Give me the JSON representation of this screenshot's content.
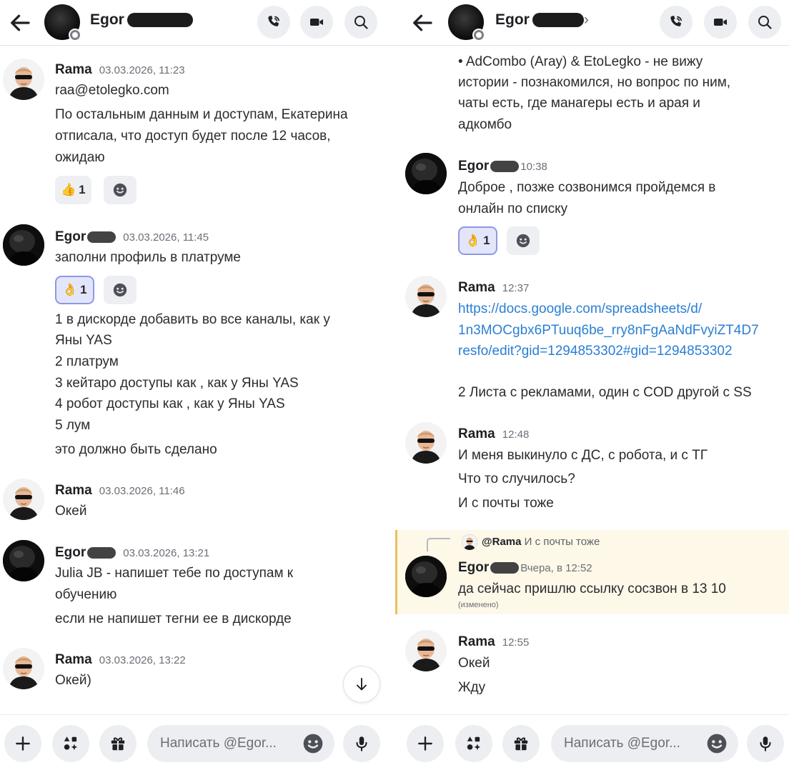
{
  "left": {
    "header": {
      "name": "Egor"
    },
    "messages": [
      {
        "author": "Rama",
        "time": "03.03.2026, 11:23",
        "lines": [
          "raa@etolegko.com",
          "По остальным данным и доступам, Екатерина",
          "отписала, что доступ будет после 12 часов,",
          "ожидаю"
        ],
        "reaction": {
          "emoji": "👍",
          "count": "1"
        }
      },
      {
        "author": "Egor",
        "time": "03.03.2026, 11:45",
        "lines": [
          "заполни профиль в платруме"
        ],
        "reaction": {
          "emoji": "👌",
          "count": "1"
        },
        "lines2": [
          "1 в дискорде добавить во все каналы,  как у",
          "Яны YAS",
          "2 платрум",
          "3 кейтаро доступы как ,  как у Яны YAS",
          "4 робот доступы как ,  как у Яны YAS",
          "5 лум",
          "это должно быть сделано"
        ]
      },
      {
        "author": "Rama",
        "time": "03.03.2026, 11:46",
        "lines": [
          "Окей"
        ]
      },
      {
        "author": "Egor",
        "time": "03.03.2026, 13:21",
        "lines": [
          "Julia JB - напишет тебе по доступам к",
          "обучению",
          "если не напишет тегни ее в дискорде"
        ]
      },
      {
        "author": "Rama",
        "time": "03.03.2026, 13:22",
        "lines": [
          "Окей)"
        ]
      }
    ],
    "composer": {
      "placeholder": "Написать @Egor..."
    }
  },
  "right": {
    "header": {
      "name": "Egor"
    },
    "top_lines": [
      "• AdCombo (Aray) & EtoLegko - не вижу",
      "истории - познакомился, но вопрос по ним,",
      "чаты есть, где манагеры есть и арая и",
      "адкомбо"
    ],
    "messages": [
      {
        "author": "Egor",
        "time": "10:38",
        "lines": [
          "Доброе , позже созвонимся пройдемся в",
          "онлайн по списку"
        ],
        "reaction": {
          "emoji": "👌",
          "count": "1"
        }
      },
      {
        "author": "Rama",
        "time": "12:37",
        "link": [
          "https://docs.google.com/spreadsheets/d/",
          "1n3MOCgbx6PTuuq6be_rry8nFgAaNdFvyiZT4D7",
          "resfo/edit?gid=1294853302#gid=1294853302"
        ],
        "lines": [
          "2 Листа с рекламами, один с COD другой с SS"
        ]
      },
      {
        "author": "Rama",
        "time": "12:48",
        "lines": [
          "И меня выкинуло с ДС, с робота, и с ТГ",
          "Что то случилось?",
          "И с почты тоже"
        ]
      },
      {
        "author": "Egor",
        "time": "Вчера, в 12:52",
        "reply_to": {
          "author": "@Rama",
          "text": "И с почты тоже"
        },
        "lines": [
          "да сейчас пришлю ссылку сосзвон в 13 10"
        ],
        "edited": "(изменено)"
      },
      {
        "author": "Rama",
        "time": "12:55",
        "lines": [
          "Окей",
          "Жду"
        ]
      }
    ],
    "composer": {
      "placeholder": "Написать @Egor..."
    }
  },
  "colors": {
    "link": "#2a7fd4",
    "reply_highlight": "#fdf8e8",
    "reply_border": "#e8c15a",
    "reaction_active": "#e3e6fb"
  }
}
